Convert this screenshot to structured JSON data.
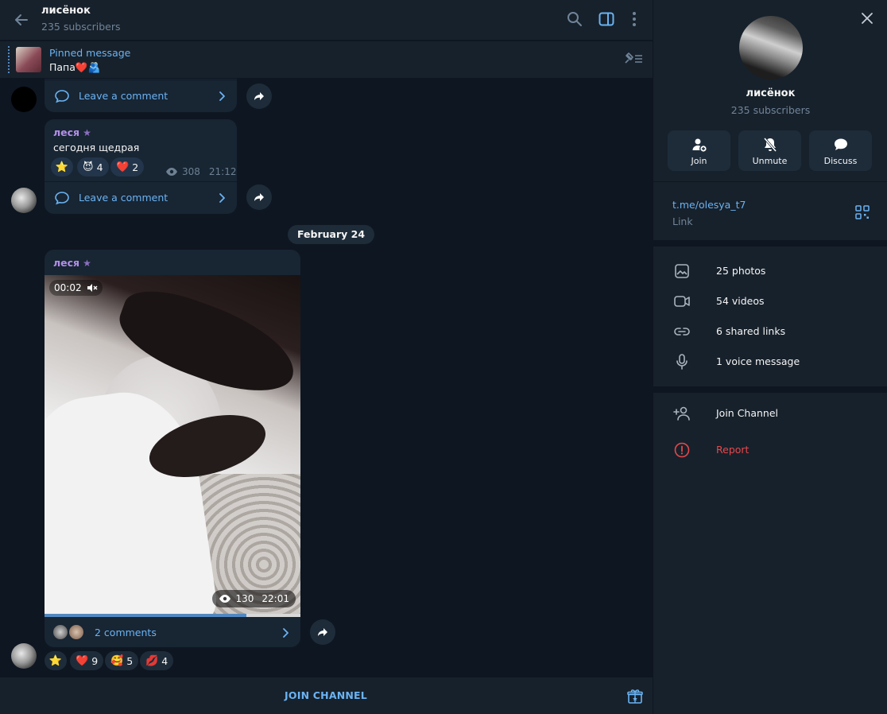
{
  "header": {
    "title": "лисёнок",
    "subtitle": "235 subscribers"
  },
  "pinned": {
    "title": "Pinned message",
    "text": "Папа❤️🫂"
  },
  "messages": {
    "first": {
      "comment_label": "Leave a comment"
    },
    "second": {
      "sender": "леся",
      "text": "сегодня щедрая",
      "reactions": [
        {
          "emoji": "⭐",
          "count": ""
        },
        {
          "emoji": "😈",
          "count": "4"
        },
        {
          "emoji": "❤️",
          "count": "2"
        }
      ],
      "views": "308",
      "time": "21:12",
      "comment_label": "Leave a comment"
    },
    "date_separator": "February 24",
    "video_post": {
      "sender": "леся",
      "duration": "00:02",
      "views": "130",
      "time": "22:01",
      "progress": 0.79,
      "comments_label": "2 comments",
      "reactions": [
        {
          "emoji": "⭐",
          "count": ""
        },
        {
          "emoji": "❤️",
          "count": "9"
        },
        {
          "emoji": "🥰",
          "count": "5"
        },
        {
          "emoji": "💋",
          "count": "4"
        }
      ]
    }
  },
  "bottom_bar": {
    "join_label": "JOIN CHANNEL"
  },
  "panel": {
    "name": "лисёнок",
    "subtitle": "235 subscribers",
    "actions": [
      {
        "label": "Join",
        "icon": "add-user-icon"
      },
      {
        "label": "Unmute",
        "icon": "bell-off-icon"
      },
      {
        "label": "Discuss",
        "icon": "chat-bubble-icon"
      }
    ],
    "link": "t.me/olesya_t7",
    "link_label": "Link",
    "media": [
      {
        "label": "25 photos",
        "icon": "photo-icon"
      },
      {
        "label": "54 videos",
        "icon": "video-icon"
      },
      {
        "label": "6 shared links",
        "icon": "link-icon"
      },
      {
        "label": "1 voice message",
        "icon": "microphone-icon"
      }
    ],
    "join_channel": "Join Channel",
    "report": "Report"
  },
  "colors": {
    "accent": "#6ab3f3",
    "background": "#0e1621",
    "panel": "#17212b",
    "bubble": "#182533",
    "sender_name": "#b38ee8",
    "danger": "#e5484d"
  }
}
